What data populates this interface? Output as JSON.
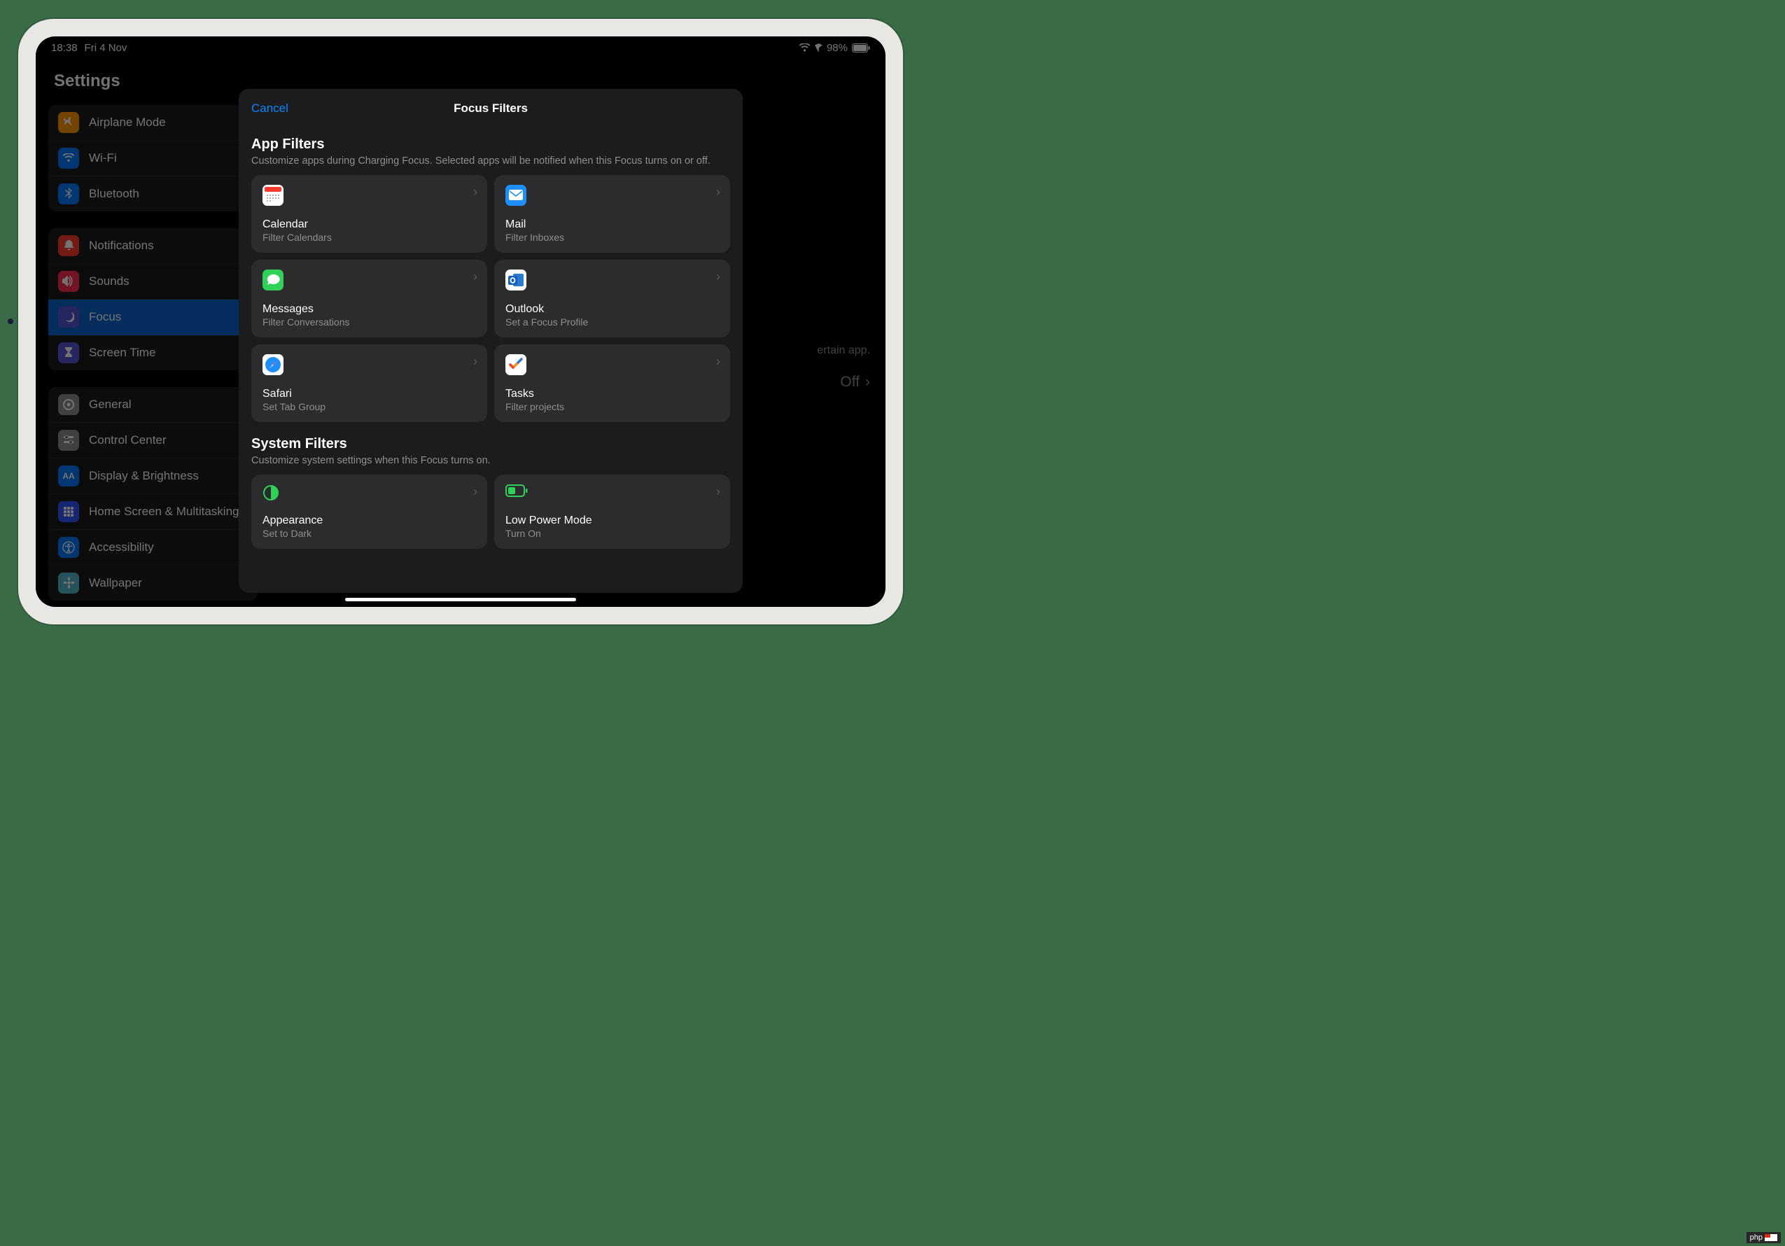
{
  "status": {
    "time": "18:38",
    "date": "Fri 4 Nov",
    "battery": "98%"
  },
  "sidebar": {
    "title": "Settings",
    "group1": [
      {
        "icon_bg": "#ff9500",
        "label": "Airplane Mode",
        "glyph": "airplane"
      },
      {
        "icon_bg": "#007aff",
        "label": "Wi-Fi",
        "glyph": "wifi"
      },
      {
        "icon_bg": "#007aff",
        "label": "Bluetooth",
        "glyph": "bluetooth"
      }
    ],
    "group2": [
      {
        "icon_bg": "#ff3b30",
        "label": "Notifications",
        "glyph": "bell"
      },
      {
        "icon_bg": "#ff2d55",
        "label": "Sounds",
        "glyph": "speaker"
      },
      {
        "icon_bg": "#5856d6",
        "label": "Focus",
        "glyph": "moon",
        "selected": true
      },
      {
        "icon_bg": "#5856d6",
        "label": "Screen Time",
        "glyph": "hourglass"
      }
    ],
    "group3": [
      {
        "icon_bg": "#8e8e93",
        "label": "General",
        "glyph": "gear"
      },
      {
        "icon_bg": "#8e8e93",
        "label": "Control Center",
        "glyph": "sliders"
      },
      {
        "icon_bg": "#007aff",
        "label": "Display & Brightness",
        "glyph": "aa"
      },
      {
        "icon_bg": "#3355ff",
        "label": "Home Screen & Multitasking",
        "glyph": "grid"
      },
      {
        "icon_bg": "#007aff",
        "label": "Accessibility",
        "glyph": "person"
      },
      {
        "icon_bg": "#55b9c9",
        "label": "Wallpaper",
        "glyph": "flower"
      }
    ]
  },
  "peek": {
    "text": "ertain app.",
    "off": "Off"
  },
  "modal": {
    "cancel": "Cancel",
    "title": "Focus Filters",
    "app_section": {
      "title": "App Filters",
      "sub": "Customize apps during Charging Focus. Selected apps will be notified when this Focus turns on or off."
    },
    "app_cards": [
      {
        "title": "Calendar",
        "sub": "Filter Calendars",
        "icon": "calendar"
      },
      {
        "title": "Mail",
        "sub": "Filter Inboxes",
        "icon": "mail"
      },
      {
        "title": "Messages",
        "sub": "Filter Conversations",
        "icon": "messages"
      },
      {
        "title": "Outlook",
        "sub": "Set a Focus Profile",
        "icon": "outlook"
      },
      {
        "title": "Safari",
        "sub": "Set Tab Group",
        "icon": "safari"
      },
      {
        "title": "Tasks",
        "sub": "Filter projects",
        "icon": "tasks"
      }
    ],
    "sys_section": {
      "title": "System Filters",
      "sub": "Customize system settings when this Focus turns on."
    },
    "sys_cards": [
      {
        "title": "Appearance",
        "sub": "Set to Dark",
        "icon": "appearance"
      },
      {
        "title": "Low Power Mode",
        "sub": "Turn On",
        "icon": "lowpower"
      }
    ]
  },
  "watermark": "php"
}
